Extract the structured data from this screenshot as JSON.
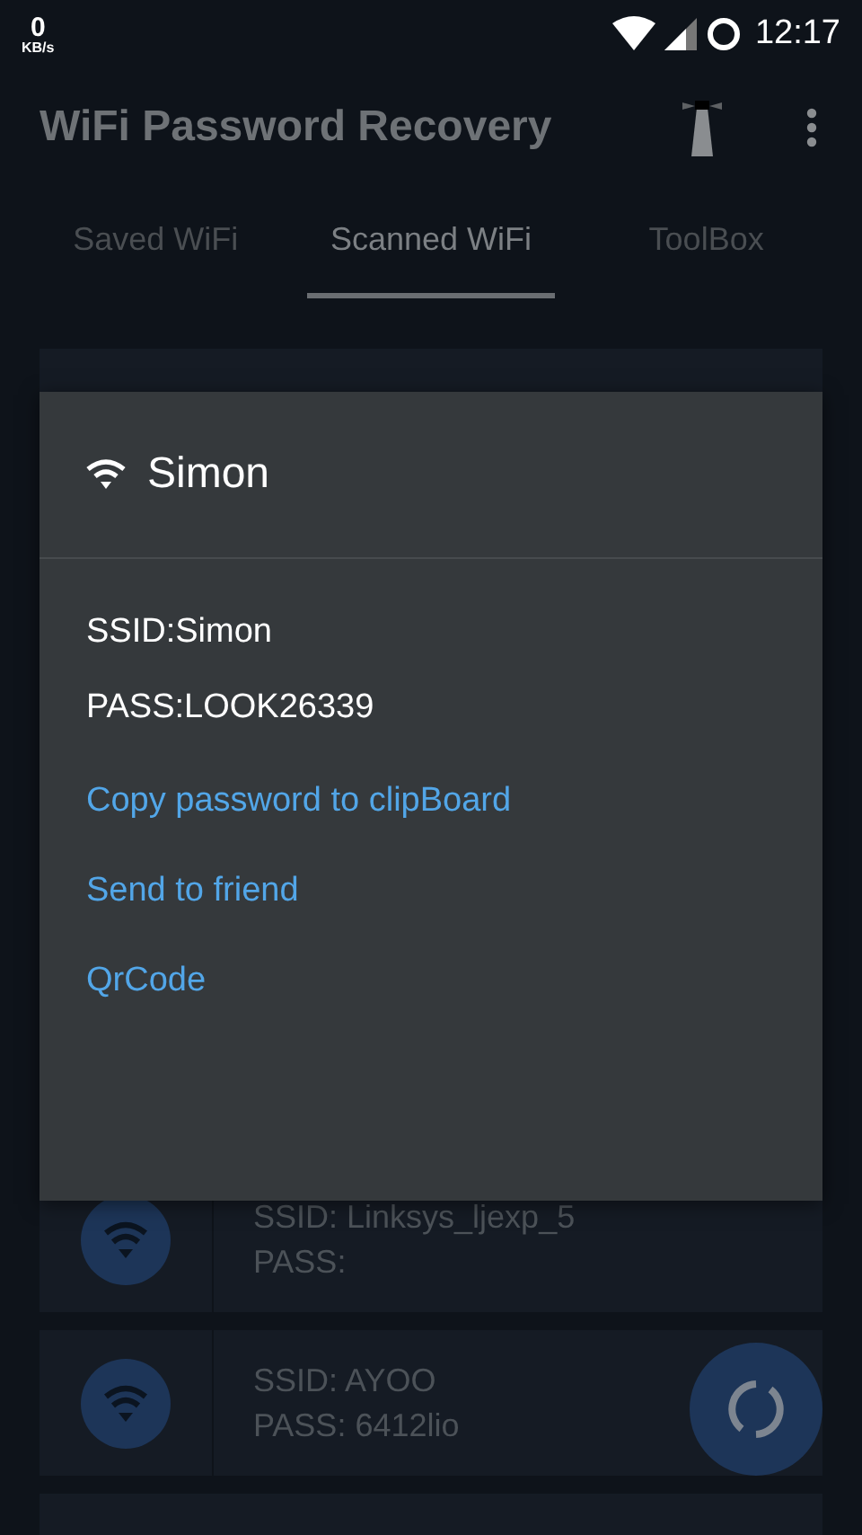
{
  "status_bar": {
    "speed": "0",
    "speed_unit": "KB/s",
    "time": "12:17"
  },
  "app_bar": {
    "title": "WiFi Password Recovery"
  },
  "tabs": [
    {
      "label": "Saved WiFi",
      "selected": false
    },
    {
      "label": "Scanned WiFi",
      "selected": true
    },
    {
      "label": "ToolBox",
      "selected": false
    }
  ],
  "networks": [
    {
      "ssid": "SSID: Linksys_ljexp_5",
      "pass": "PASS:"
    },
    {
      "ssid": "SSID: AYOO",
      "pass": "PASS: 6412lio"
    }
  ],
  "dialog": {
    "title": "Simon",
    "details": [
      "SSID:Simon",
      "PASS:LOOK26339"
    ],
    "actions": [
      "Copy password to clipBoard",
      "Send to friend",
      "QrCode"
    ]
  }
}
